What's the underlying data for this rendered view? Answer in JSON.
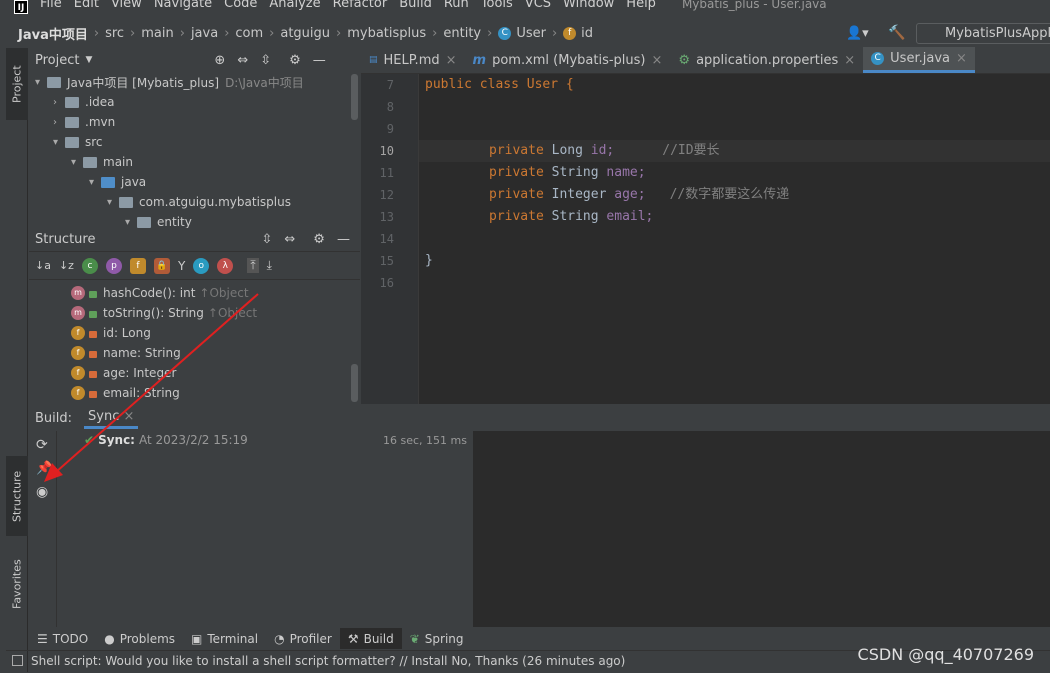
{
  "menu": {
    "items": [
      "File",
      "Edit",
      "View",
      "Navigate",
      "Code",
      "Analyze",
      "Refactor",
      "Build",
      "Run",
      "Tools",
      "VCS",
      "Window",
      "Help"
    ],
    "title": "Mybatis_plus - User.java"
  },
  "breadcrumb": {
    "project": "Java中项目",
    "items": [
      "src",
      "main",
      "java",
      "com",
      "atguigu",
      "mybatisplus",
      "entity",
      "User",
      "id"
    ]
  },
  "run_config": "MybatisPlusApplic",
  "side_tabs": {
    "project": "Project",
    "structure": "Structure",
    "favorites": "Favorites"
  },
  "project_panel": {
    "title": "Project",
    "root_label": "Java中项目 [Mybatis_plus]",
    "root_path": "D:\\Java中项目",
    "items": [
      ".idea",
      ".mvn",
      "src",
      "main",
      "java",
      "com.atguigu.mybatisplus",
      "entity"
    ]
  },
  "structure_panel": {
    "title": "Structure",
    "rows": [
      {
        "badge": "m",
        "name": "hashCode(): int",
        "suffix": "↑Object"
      },
      {
        "badge": "m",
        "name": "toString(): String",
        "suffix": "↑Object"
      },
      {
        "badge": "f",
        "name": "id: Long",
        "suffix": ""
      },
      {
        "badge": "f",
        "name": "name: String",
        "suffix": ""
      },
      {
        "badge": "f",
        "name": "age: Integer",
        "suffix": ""
      },
      {
        "badge": "f",
        "name": "email: String",
        "suffix": ""
      }
    ]
  },
  "editor_tabs": [
    {
      "label": "HELP.md"
    },
    {
      "label": "pom.xml (Mybatis-plus)"
    },
    {
      "label": "application.properties"
    },
    {
      "label": "User.java"
    }
  ],
  "code": {
    "line_numbers": [
      "7",
      "8",
      "9",
      "10",
      "11",
      "12",
      "13",
      "14",
      "15",
      "16"
    ],
    "line7": "public class User {",
    "l10_kw": "private ",
    "l10_ty": "Long ",
    "l10_fd": "id;",
    "l10_cm": "//ID要长",
    "l11_kw": "private ",
    "l11_ty": "String ",
    "l11_fd": "name;",
    "l12_kw": "private ",
    "l12_ty": "Integer ",
    "l12_fd": "age;",
    "l12_cm": "//数字都要这么传递",
    "l13_kw": "private ",
    "l13_ty": "String ",
    "l13_fd": "email;",
    "line15": "}"
  },
  "build": {
    "label": "Build:",
    "tab": "Sync",
    "sync_label": "Sync:",
    "sync_time": "At 2023/2/2 15:19",
    "duration": "16 sec, 151 ms"
  },
  "bottom_tabs": [
    "TODO",
    "Problems",
    "Terminal",
    "Profiler",
    "Build",
    "Spring"
  ],
  "status": {
    "message": "Shell script: Would you like to install a shell script formatter? // Install    No, Thanks (26 minutes ago)"
  },
  "watermark": "CSDN @qq_40707269",
  "colors": {
    "accent": "#4a88c7",
    "keyword": "#cc7832",
    "field": "#9876aa",
    "comment": "#808080",
    "annotation_arrow": "#e02020"
  }
}
